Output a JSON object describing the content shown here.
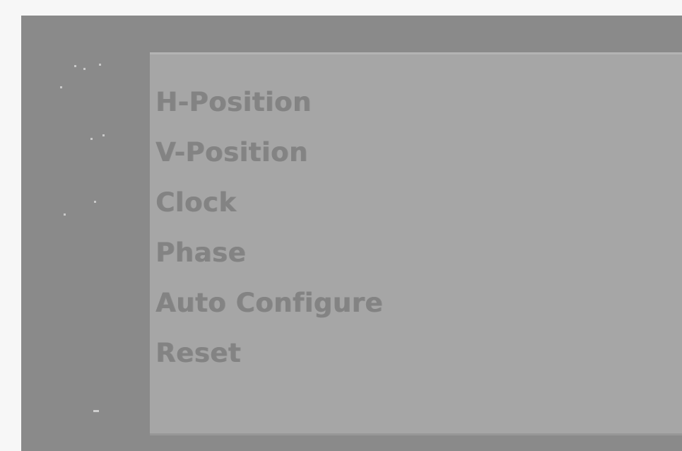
{
  "osd_menu": {
    "items": [
      {
        "label": "H-Position"
      },
      {
        "label": "V-Position"
      },
      {
        "label": "Clock"
      },
      {
        "label": "Phase"
      },
      {
        "label": "Auto Configure"
      },
      {
        "label": "Reset"
      }
    ]
  },
  "colors": {
    "frame_background": "#8a8a8a",
    "panel_background": "#a6a6a6",
    "item_text": "#838383"
  }
}
